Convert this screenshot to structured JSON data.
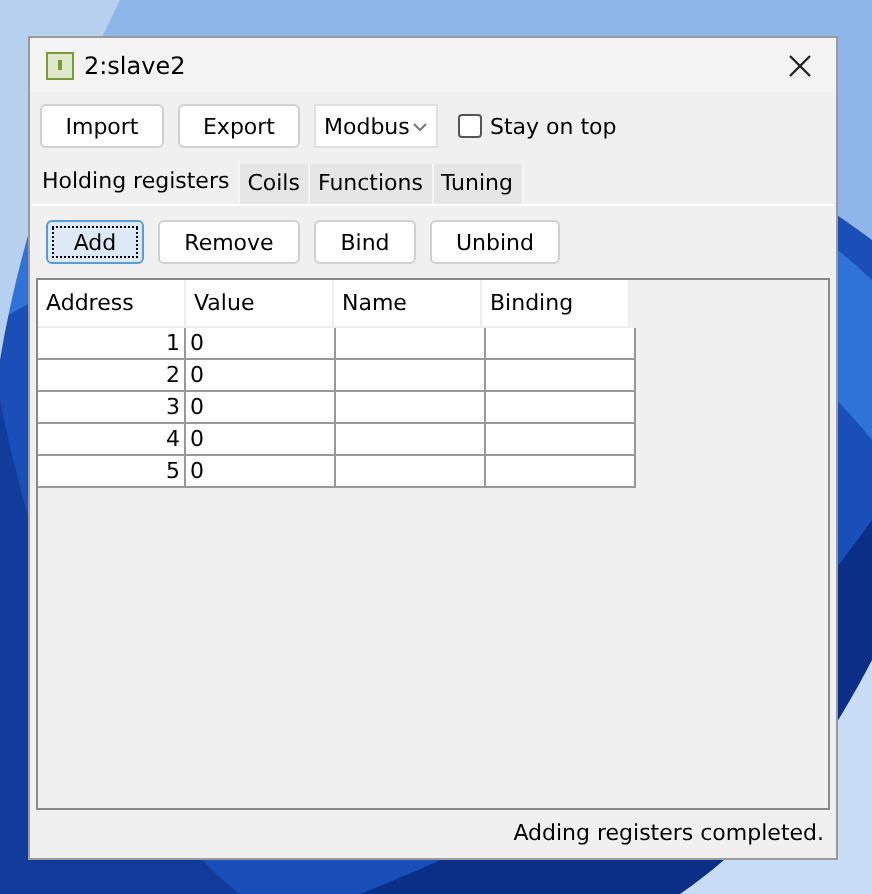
{
  "window": {
    "title": "2:slave2"
  },
  "toolbar": {
    "buttons": [
      "Import",
      "Export"
    ],
    "protocol": "Modbus",
    "stay_on_top": {
      "label": "Stay on top",
      "checked": false
    }
  },
  "tabs": [
    {
      "label": "Holding registers",
      "selected": true
    },
    {
      "label": "Coils",
      "selected": false
    },
    {
      "label": "Functions",
      "selected": false
    },
    {
      "label": "Tuning",
      "selected": false
    }
  ],
  "actions": [
    {
      "label": "Add",
      "focused": true
    },
    {
      "label": "Remove",
      "focused": false
    },
    {
      "label": "Bind",
      "focused": false
    },
    {
      "label": "Unbind",
      "focused": false
    }
  ],
  "table": {
    "columns": [
      "Address",
      "Value",
      "Name",
      "Binding"
    ],
    "rows": [
      [
        "1",
        "0",
        "",
        ""
      ],
      [
        "2",
        "0",
        "",
        ""
      ],
      [
        "3",
        "0",
        "",
        ""
      ],
      [
        "4",
        "0",
        "",
        ""
      ],
      [
        "5",
        "0",
        "",
        ""
      ]
    ]
  },
  "status_bar": "Adding registers completed."
}
